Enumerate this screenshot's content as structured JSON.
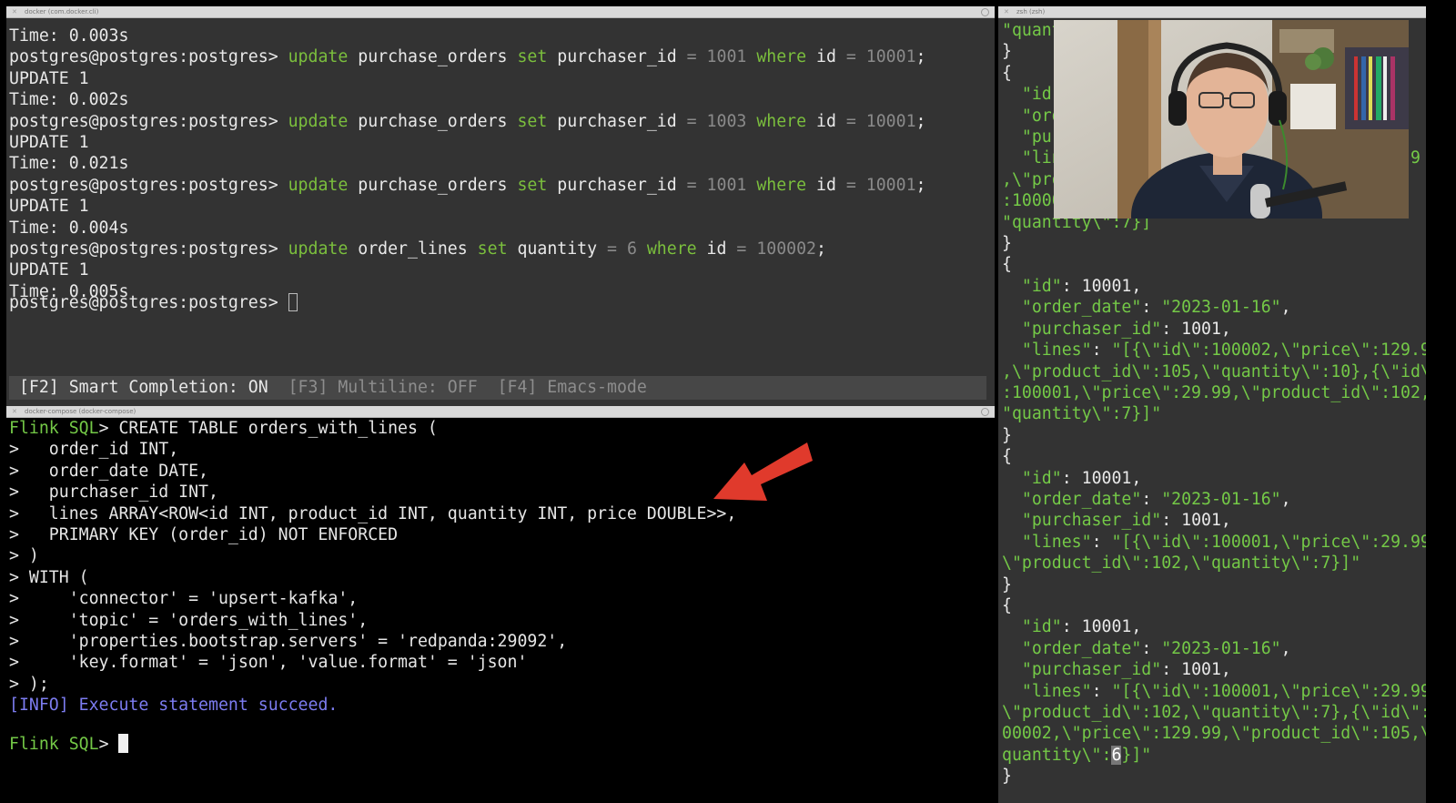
{
  "window_titles": {
    "psql": "docker (com.docker.cli)",
    "kcat": "zsh (zsh)",
    "flink": "docker-compose (docker-compose)"
  },
  "psql": {
    "lines": [
      [
        {
          "t": "Time: 0.003s",
          "c": "plain"
        }
      ],
      [
        {
          "t": "postgres@postgres:postgres> ",
          "c": "plain"
        },
        {
          "t": "update",
          "c": "kw"
        },
        {
          "t": " purchase_orders ",
          "c": "plain"
        },
        {
          "t": "set",
          "c": "kw"
        },
        {
          "t": " purchaser_id ",
          "c": "plain"
        },
        {
          "t": "=",
          "c": "op"
        },
        {
          "t": " ",
          "c": "plain"
        },
        {
          "t": "1001",
          "c": "num"
        },
        {
          "t": " ",
          "c": "plain"
        },
        {
          "t": "where",
          "c": "kw"
        },
        {
          "t": " id ",
          "c": "plain"
        },
        {
          "t": "=",
          "c": "op"
        },
        {
          "t": " ",
          "c": "plain"
        },
        {
          "t": "10001",
          "c": "num"
        },
        {
          "t": ";",
          "c": "plain"
        }
      ],
      [
        {
          "t": "UPDATE 1",
          "c": "plain"
        }
      ],
      [
        {
          "t": "Time: 0.002s",
          "c": "plain"
        }
      ],
      [
        {
          "t": "postgres@postgres:postgres> ",
          "c": "plain"
        },
        {
          "t": "update",
          "c": "kw"
        },
        {
          "t": " purchase_orders ",
          "c": "plain"
        },
        {
          "t": "set",
          "c": "kw"
        },
        {
          "t": " purchaser_id ",
          "c": "plain"
        },
        {
          "t": "=",
          "c": "op"
        },
        {
          "t": " ",
          "c": "plain"
        },
        {
          "t": "1003",
          "c": "num"
        },
        {
          "t": " ",
          "c": "plain"
        },
        {
          "t": "where",
          "c": "kw"
        },
        {
          "t": " id ",
          "c": "plain"
        },
        {
          "t": "=",
          "c": "op"
        },
        {
          "t": " ",
          "c": "plain"
        },
        {
          "t": "10001",
          "c": "num"
        },
        {
          "t": ";",
          "c": "plain"
        }
      ],
      [
        {
          "t": "UPDATE 1",
          "c": "plain"
        }
      ],
      [
        {
          "t": "Time: 0.021s",
          "c": "plain"
        }
      ],
      [
        {
          "t": "postgres@postgres:postgres> ",
          "c": "plain"
        },
        {
          "t": "update",
          "c": "kw"
        },
        {
          "t": " purchase_orders ",
          "c": "plain"
        },
        {
          "t": "set",
          "c": "kw"
        },
        {
          "t": " purchaser_id ",
          "c": "plain"
        },
        {
          "t": "=",
          "c": "op"
        },
        {
          "t": " ",
          "c": "plain"
        },
        {
          "t": "1001",
          "c": "num"
        },
        {
          "t": " ",
          "c": "plain"
        },
        {
          "t": "where",
          "c": "kw"
        },
        {
          "t": " id ",
          "c": "plain"
        },
        {
          "t": "=",
          "c": "op"
        },
        {
          "t": " ",
          "c": "plain"
        },
        {
          "t": "10001",
          "c": "num"
        },
        {
          "t": ";",
          "c": "plain"
        }
      ],
      [
        {
          "t": "UPDATE 1",
          "c": "plain"
        }
      ],
      [
        {
          "t": "Time: 0.004s",
          "c": "plain"
        }
      ],
      [
        {
          "t": "postgres@postgres:postgres> ",
          "c": "plain"
        },
        {
          "t": "update",
          "c": "kw"
        },
        {
          "t": " order_lines ",
          "c": "plain"
        },
        {
          "t": "set",
          "c": "kw"
        },
        {
          "t": " quantity ",
          "c": "plain"
        },
        {
          "t": "=",
          "c": "op"
        },
        {
          "t": " ",
          "c": "plain"
        },
        {
          "t": "6",
          "c": "num"
        },
        {
          "t": " ",
          "c": "plain"
        },
        {
          "t": "where",
          "c": "kw"
        },
        {
          "t": " id ",
          "c": "plain"
        },
        {
          "t": "=",
          "c": "op"
        },
        {
          "t": " ",
          "c": "plain"
        },
        {
          "t": "100002",
          "c": "num"
        },
        {
          "t": ";",
          "c": "plain"
        }
      ],
      [
        {
          "t": "UPDATE 1",
          "c": "plain"
        }
      ],
      [
        {
          "t": "Time: 0.005s",
          "c": "plain"
        }
      ]
    ],
    "prompt": "postgres@postgres:postgres> ",
    "toolbar": {
      "f2": "[F2] Smart Completion: ON",
      "f3": "[F3] Multiline: OFF",
      "f4": "[F4] Emacs-mode"
    }
  },
  "flink": {
    "lines": [
      [
        {
          "t": "Flink SQL",
          "c": "prompt-green"
        },
        {
          "t": "> CREATE TABLE orders_with_lines (",
          "c": "plain"
        }
      ],
      [
        {
          "t": ">   order_id INT,",
          "c": "plain"
        }
      ],
      [
        {
          "t": ">   order_date DATE,",
          "c": "plain"
        }
      ],
      [
        {
          "t": ">   purchaser_id INT,",
          "c": "plain"
        }
      ],
      [
        {
          "t": ">   lines ARRAY<ROW<id INT, product_id INT, quantity INT, price DOUBLE>>,",
          "c": "plain"
        }
      ],
      [
        {
          "t": ">   PRIMARY KEY (order_id) NOT ENFORCED",
          "c": "plain"
        }
      ],
      [
        {
          "t": "> )",
          "c": "plain"
        }
      ],
      [
        {
          "t": "> WITH (",
          "c": "plain"
        }
      ],
      [
        {
          "t": ">     'connector' = 'upsert-kafka',",
          "c": "plain"
        }
      ],
      [
        {
          "t": ">     'topic' = 'orders_with_lines',",
          "c": "plain"
        }
      ],
      [
        {
          "t": ">     'properties.bootstrap.servers' = 'redpanda:29092',",
          "c": "plain"
        }
      ],
      [
        {
          "t": ">     'key.format' = 'json', 'value.format' = 'json'",
          "c": "plain"
        }
      ],
      [
        {
          "t": "> );",
          "c": "plain"
        }
      ],
      [
        {
          "t": "[INFO] Execute statement succeed.",
          "c": "info"
        }
      ],
      [
        {
          "t": "",
          "c": "plain"
        }
      ]
    ],
    "prompt_label": "Flink SQL",
    "prompt_suffix": "> "
  },
  "kcat": {
    "lines": [
      [
        {
          "t": "\"quant",
          "c": "jkey"
        }
      ],
      [
        {
          "t": "}",
          "c": "plain"
        }
      ],
      [
        {
          "t": "{",
          "c": "plain"
        }
      ],
      [
        {
          "t": "  ",
          "c": "plain"
        },
        {
          "t": "\"id\"",
          "c": "jkey"
        }
      ],
      [
        {
          "t": "  ",
          "c": "plain"
        },
        {
          "t": "\"ord",
          "c": "jkey"
        }
      ],
      [
        {
          "t": "  ",
          "c": "plain"
        },
        {
          "t": "\"pur",
          "c": "jkey"
        }
      ],
      [
        {
          "t": "  ",
          "c": "plain"
        },
        {
          "t": "\"lin",
          "c": "jkey"
        },
        {
          "t": "                                   9",
          "c": "jstr"
        }
      ],
      [
        {
          "t": ",\\\"pro",
          "c": "jstr"
        },
        {
          "t": "                                       \"",
          "c": "jstr"
        }
      ],
      [
        {
          "t": ":10000",
          "c": "jstr"
        },
        {
          "t": "                                       \\",
          "c": "jstr"
        }
      ],
      [
        {
          "t": "\"quantity\\\":7}]",
          "c": "jstr"
        }
      ],
      [
        {
          "t": "}",
          "c": "plain"
        }
      ],
      [
        {
          "t": "{",
          "c": "plain"
        }
      ],
      [
        {
          "t": "  ",
          "c": "plain"
        },
        {
          "t": "\"id\"",
          "c": "jkey"
        },
        {
          "t": ": 10001,",
          "c": "plain"
        }
      ],
      [
        {
          "t": "  ",
          "c": "plain"
        },
        {
          "t": "\"order_date\"",
          "c": "jkey"
        },
        {
          "t": ": ",
          "c": "plain"
        },
        {
          "t": "\"2023-01-16\"",
          "c": "jstr"
        },
        {
          "t": ",",
          "c": "plain"
        }
      ],
      [
        {
          "t": "  ",
          "c": "plain"
        },
        {
          "t": "\"purchaser_id\"",
          "c": "jkey"
        },
        {
          "t": ": 1001,",
          "c": "plain"
        }
      ],
      [
        {
          "t": "  ",
          "c": "plain"
        },
        {
          "t": "\"lines\"",
          "c": "jkey"
        },
        {
          "t": ": ",
          "c": "plain"
        },
        {
          "t": "\"[{\\\"id\\\":100002,\\\"price\\\":129.99",
          "c": "jstr"
        }
      ],
      [
        {
          "t": ",\\\"product_id\\\":105,\\\"quantity\\\":10},{\\\"id\\\"",
          "c": "jstr"
        }
      ],
      [
        {
          "t": ":100001,\\\"price\\\":29.99,\\\"product_id\\\":102,\\",
          "c": "jstr"
        }
      ],
      [
        {
          "t": "\"quantity\\\":7}]\"",
          "c": "jstr"
        }
      ],
      [
        {
          "t": "}",
          "c": "plain"
        }
      ],
      [
        {
          "t": "{",
          "c": "plain"
        }
      ],
      [
        {
          "t": "  ",
          "c": "plain"
        },
        {
          "t": "\"id\"",
          "c": "jkey"
        },
        {
          "t": ": 10001,",
          "c": "plain"
        }
      ],
      [
        {
          "t": "  ",
          "c": "plain"
        },
        {
          "t": "\"order_date\"",
          "c": "jkey"
        },
        {
          "t": ": ",
          "c": "plain"
        },
        {
          "t": "\"2023-01-16\"",
          "c": "jstr"
        },
        {
          "t": ",",
          "c": "plain"
        }
      ],
      [
        {
          "t": "  ",
          "c": "plain"
        },
        {
          "t": "\"purchaser_id\"",
          "c": "jkey"
        },
        {
          "t": ": 1001,",
          "c": "plain"
        }
      ],
      [
        {
          "t": "  ",
          "c": "plain"
        },
        {
          "t": "\"lines\"",
          "c": "jkey"
        },
        {
          "t": ": ",
          "c": "plain"
        },
        {
          "t": "\"[{\\\"id\\\":100001,\\\"price\\\":29.99,",
          "c": "jstr"
        }
      ],
      [
        {
          "t": "\\\"product_id\\\":102,\\\"quantity\\\":7}]\"",
          "c": "jstr"
        }
      ],
      [
        {
          "t": "}",
          "c": "plain"
        }
      ],
      [
        {
          "t": "{",
          "c": "plain"
        }
      ],
      [
        {
          "t": "  ",
          "c": "plain"
        },
        {
          "t": "\"id\"",
          "c": "jkey"
        },
        {
          "t": ": 10001,",
          "c": "plain"
        }
      ],
      [
        {
          "t": "  ",
          "c": "plain"
        },
        {
          "t": "\"order_date\"",
          "c": "jkey"
        },
        {
          "t": ": ",
          "c": "plain"
        },
        {
          "t": "\"2023-01-16\"",
          "c": "jstr"
        },
        {
          "t": ",",
          "c": "plain"
        }
      ],
      [
        {
          "t": "  ",
          "c": "plain"
        },
        {
          "t": "\"purchaser_id\"",
          "c": "jkey"
        },
        {
          "t": ": 1001,",
          "c": "plain"
        }
      ],
      [
        {
          "t": "  ",
          "c": "plain"
        },
        {
          "t": "\"lines\"",
          "c": "jkey"
        },
        {
          "t": ": ",
          "c": "plain"
        },
        {
          "t": "\"[{\\\"id\\\":100001,\\\"price\\\":29.99,",
          "c": "jstr"
        }
      ],
      [
        {
          "t": "\\\"product_id\\\":102,\\\"quantity\\\":7},{\\\"id\\\":1",
          "c": "jstr"
        }
      ],
      [
        {
          "t": "00002,\\\"price\\\":129.99,\\\"product_id\\\":105,\\\"",
          "c": "jstr"
        }
      ],
      [
        {
          "t": "quantity\\\":",
          "c": "jstr"
        },
        {
          "t": "6",
          "c": "hl"
        },
        {
          "t": "}]\"",
          "c": "jstr"
        }
      ],
      [
        {
          "t": "}",
          "c": "plain"
        }
      ]
    ]
  },
  "colors": {
    "keyword": "#7bbf3d",
    "json_green": "#74c947",
    "info": "#7c7cf0",
    "arrow": "#e03a2c"
  }
}
